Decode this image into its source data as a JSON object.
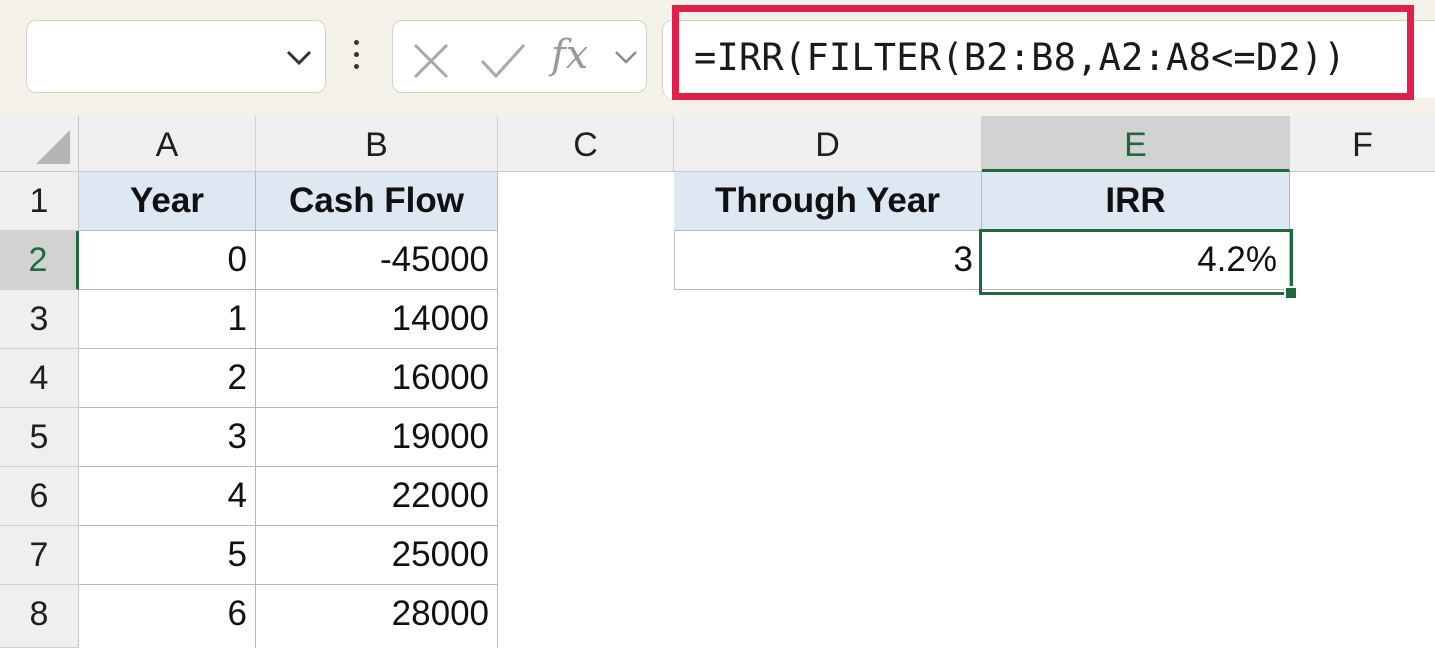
{
  "formula_bar": {
    "name_box": "",
    "formula": "=IRR(FILTER(B2:B8,A2:A8<=D2))",
    "fx_label": "fx"
  },
  "columns": [
    "A",
    "B",
    "C",
    "D",
    "E",
    "F"
  ],
  "rows": [
    "1",
    "2",
    "3",
    "4",
    "5",
    "6",
    "7",
    "8"
  ],
  "table": {
    "header_year": "Year",
    "header_cash": "Cash Flow",
    "years": [
      "0",
      "1",
      "2",
      "3",
      "4",
      "5",
      "6"
    ],
    "cash_flows": [
      "-45000",
      "14000",
      "16000",
      "19000",
      "22000",
      "25000",
      "28000"
    ]
  },
  "irr_block": {
    "header_through": "Through Year",
    "header_irr": "IRR",
    "through_value": "3",
    "irr_value": "4.2%"
  },
  "colors": {
    "highlight": "#e0204a",
    "selection": "#1e6a3e",
    "header_fill": "#dde8f2"
  },
  "icons": [
    "chevron-down-icon",
    "more-options-icon",
    "cancel-icon",
    "enter-icon",
    "fx-icon",
    "fx-chevron-icon",
    "select-all-icon"
  ]
}
